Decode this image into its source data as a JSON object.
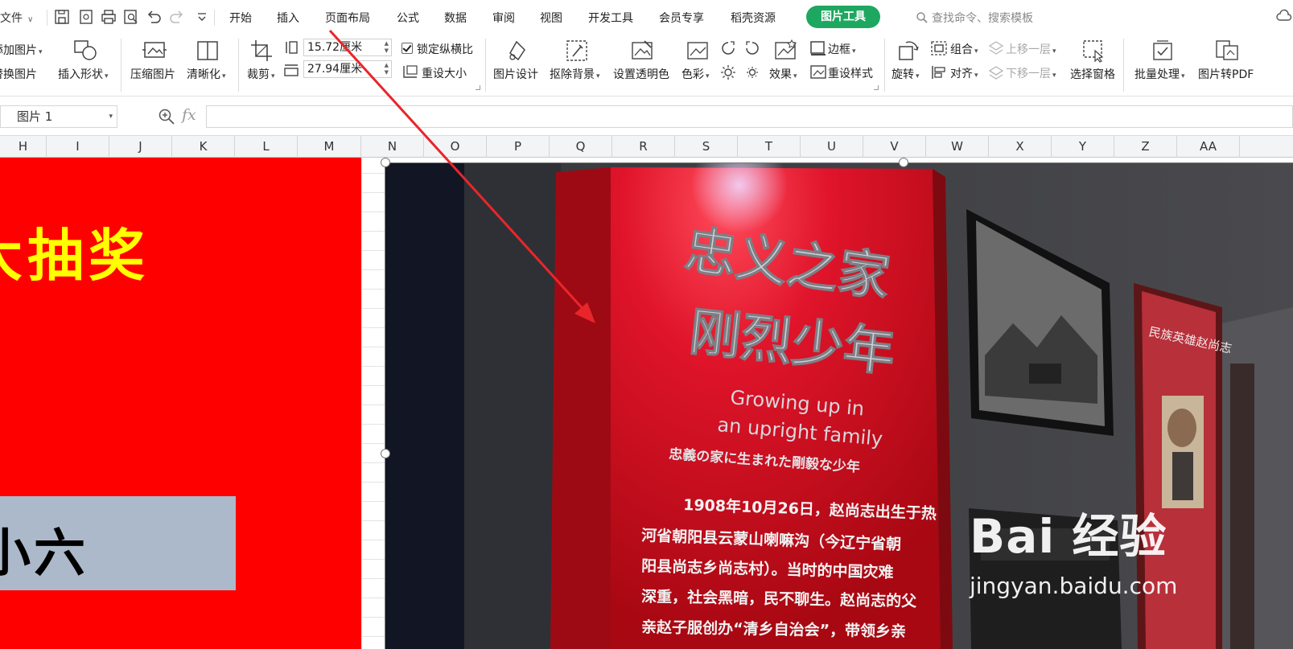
{
  "menubar": {
    "file_label": "文件",
    "tabs": [
      "开始",
      "插入",
      "页面布局",
      "公式",
      "数据",
      "审阅",
      "视图",
      "开发工具",
      "会员专享",
      "稻壳资源"
    ],
    "active_tab": "图片工具",
    "search_placeholder": "查找命令、搜索模板"
  },
  "ribbon": {
    "add_picture": "添加图片",
    "replace_picture": "替换图片",
    "insert_shape": "插入形状",
    "compress": "压缩图片",
    "sharpen": "清晰化",
    "crop": "裁剪",
    "height_value": "15.72厘米",
    "width_value": "27.94厘米",
    "lock_ratio": "锁定纵横比",
    "reset_size": "重设大小",
    "picture_design": "图片设计",
    "remove_bg": "抠除背景",
    "set_transparent": "设置透明色",
    "color": "色彩",
    "effect": "效果",
    "border": "边框",
    "reset_style": "重设样式",
    "rotate": "旋转",
    "group": "组合",
    "align": "对齐",
    "bring_forward": "上移一层",
    "send_backward": "下移一层",
    "selection_pane": "选择窗格",
    "batch": "批量处理",
    "to_pdf": "图片转PDF"
  },
  "formula_bar": {
    "name_box": "图片 1",
    "fx": "fx",
    "formula": ""
  },
  "columns": [
    "H",
    "I",
    "J",
    "K",
    "L",
    "M",
    "N",
    "O",
    "P",
    "Q",
    "R",
    "S",
    "T",
    "U",
    "V",
    "W",
    "X",
    "Y",
    "Z",
    "AA"
  ],
  "sheet": {
    "lottery_text": "大抽奖",
    "grey_text": "小六"
  },
  "photo": {
    "title_line1": "忠义之家",
    "title_line2": "刚烈少年",
    "english_line1": "Growing up in",
    "english_line2": "an upright family",
    "japanese_line": "忠義の家に生まれた剛毅な少年",
    "body_lines": [
      "1908年10月26日，赵尚志出生于热",
      "河省朝阳县云蒙山喇嘛沟（今辽宁省朝",
      "阳县尚志乡尚志村）。当时的中国灾难",
      "深重，社会黑暗，民不聊生。赵尚志的父",
      "亲赵子服创办“清乡自治会”，带领乡亲"
    ],
    "side_panel_title": "民族英雄赵尚志"
  },
  "watermark": {
    "brand": "Bai  经验",
    "url": "jingyan.baidu.com"
  },
  "colors": {
    "accent_green": "#1ea760",
    "sheet_red": "#ff0000",
    "lottery_yellow": "#ffff00",
    "grey_box": "#acb9ca",
    "arrow_red": "#e8262a"
  }
}
